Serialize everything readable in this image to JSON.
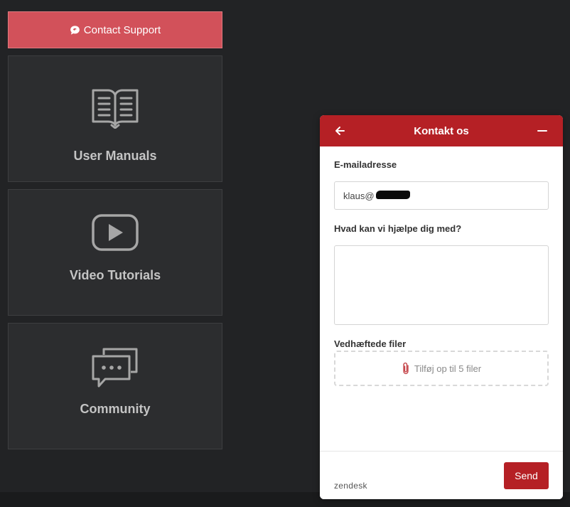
{
  "sidebar": {
    "contact_button": {
      "label": "Contact Support",
      "icon": "chat-bubble-icon",
      "color": "#d2515a"
    },
    "cards": [
      {
        "label": "User Manuals",
        "icon": "open-book-icon"
      },
      {
        "label": "Video Tutorials",
        "icon": "play-icon"
      },
      {
        "label": "Community",
        "icon": "chat-bubbles-icon"
      }
    ]
  },
  "widget": {
    "header": {
      "title": "Kontakt os",
      "back_icon": "arrow-left-icon",
      "minimize_icon": "minus-icon",
      "color": "#b52025"
    },
    "email": {
      "label": "E-mailadresse",
      "value": "klaus@"
    },
    "message": {
      "label": "Hvad kan vi hjælpe dig med?",
      "value": ""
    },
    "attachments": {
      "label": "Vedhæftede filer",
      "dropzone_text": "Tilføj op til 5 filer",
      "icon": "paperclip-icon"
    },
    "footer": {
      "brand": "zendesk",
      "send_label": "Send"
    }
  }
}
